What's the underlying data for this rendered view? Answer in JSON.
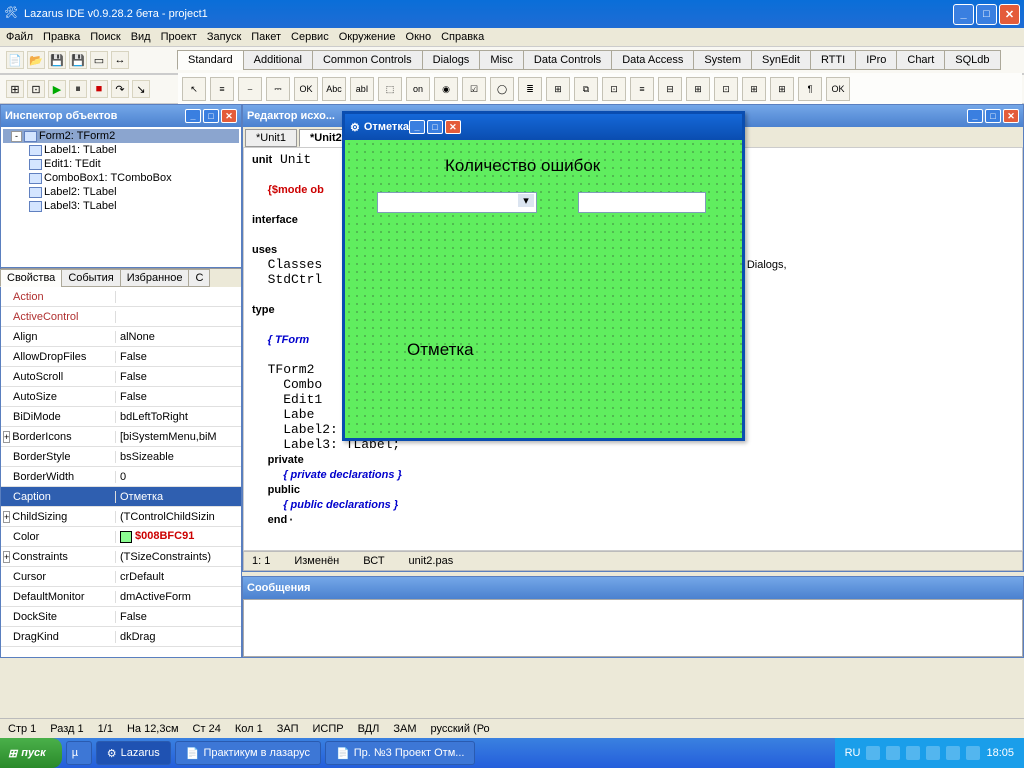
{
  "main_window": {
    "title": "Lazarus IDE v0.9.28.2 бета - project1"
  },
  "menu": [
    "Файл",
    "Правка",
    "Поиск",
    "Вид",
    "Проект",
    "Запуск",
    "Пакет",
    "Сервис",
    "Окружение",
    "Окно",
    "Справка"
  ],
  "component_tabs": [
    "Standard",
    "Additional",
    "Common Controls",
    "Dialogs",
    "Misc",
    "Data Controls",
    "Data Access",
    "System",
    "SynEdit",
    "RTTI",
    "IPro",
    "Chart",
    "SQLdb"
  ],
  "component_tabs_active": 0,
  "inspector": {
    "title": "Инспектор объектов",
    "tree": [
      {
        "level": 0,
        "label": "Form2: TForm2",
        "exp": "-",
        "sel": true
      },
      {
        "level": 1,
        "label": "Label1: TLabel"
      },
      {
        "level": 1,
        "label": "Edit1: TEdit"
      },
      {
        "level": 1,
        "label": "ComboBox1: TComboBox"
      },
      {
        "level": 1,
        "label": "Label2: TLabel"
      },
      {
        "level": 1,
        "label": "Label3: TLabel"
      }
    ],
    "prop_tabs": [
      "Свойства",
      "События",
      "Избранное",
      "С"
    ],
    "prop_tabs_active": 0,
    "props": [
      {
        "name": "Action",
        "val": "",
        "color": "#b03030"
      },
      {
        "name": "ActiveControl",
        "val": "",
        "color": "#b03030"
      },
      {
        "name": "Align",
        "val": "alNone"
      },
      {
        "name": "AllowDropFiles",
        "val": "False"
      },
      {
        "name": "AutoScroll",
        "val": "False"
      },
      {
        "name": "AutoSize",
        "val": "False"
      },
      {
        "name": "BiDiMode",
        "val": "bdLeftToRight"
      },
      {
        "name": "BorderIcons",
        "val": "[biSystemMenu,biM",
        "exp": "+"
      },
      {
        "name": "BorderStyle",
        "val": "bsSizeable"
      },
      {
        "name": "BorderWidth",
        "val": "0"
      },
      {
        "name": "Caption",
        "val": "Отметка",
        "sel": true
      },
      {
        "name": "ChildSizing",
        "val": "(TControlChildSizin",
        "exp": "+"
      },
      {
        "name": "Color",
        "val": "$008BFC91",
        "colorbox": "#8bfc91"
      },
      {
        "name": "Constraints",
        "val": "(TSizeConstraints)",
        "exp": "+"
      },
      {
        "name": "Cursor",
        "val": "crDefault"
      },
      {
        "name": "DefaultMonitor",
        "val": "dmActiveForm"
      },
      {
        "name": "DockSite",
        "val": "False"
      },
      {
        "name": "DragKind",
        "val": "dkDrag"
      }
    ]
  },
  "editor": {
    "title": "Редактор исхо...",
    "tabs": [
      "*Unit1",
      "*Unit2"
    ],
    "active_tab": 1,
    "status": {
      "pos": "1: 1",
      "state": "Изменён",
      "ins": "ВСТ",
      "file": "unit2.pas"
    }
  },
  "messages_title": "Сообщения",
  "form_designer": {
    "title": "Отметка",
    "label1": "Количество ошибок",
    "label2": "Отметка"
  },
  "bottom_status": [
    "Стр 1",
    "Разд 1",
    "1/1",
    "На 12,3см",
    "Ст 24",
    "Кол 1",
    "ЗАП",
    "ИСПР",
    "ВДЛ",
    "ЗАМ",
    "русский (Ро"
  ],
  "taskbar": {
    "start": "пуск",
    "items": [
      {
        "label": "Lazarus",
        "active": true,
        "icon": "⚙"
      },
      {
        "label": "Практикум в лазарус",
        "active": false,
        "icon": "📄"
      },
      {
        "label": "Пр. №3 Проект Отм...",
        "active": false,
        "icon": "📄"
      }
    ],
    "lang": "RU",
    "time": "18:05"
  },
  "code_extra": "Graphics, Dialogs,",
  "palette_items": [
    "↖",
    "≡",
    "⎯",
    "⎓",
    "OK",
    "Abc",
    "abI",
    "⬚",
    "on",
    "◉",
    "☑",
    "◯",
    "≣",
    "⊞",
    "⧉",
    "⊡",
    "≡",
    "⊟",
    "⊞",
    "⊡",
    "⊞",
    "⊞",
    "¶",
    "OK"
  ]
}
